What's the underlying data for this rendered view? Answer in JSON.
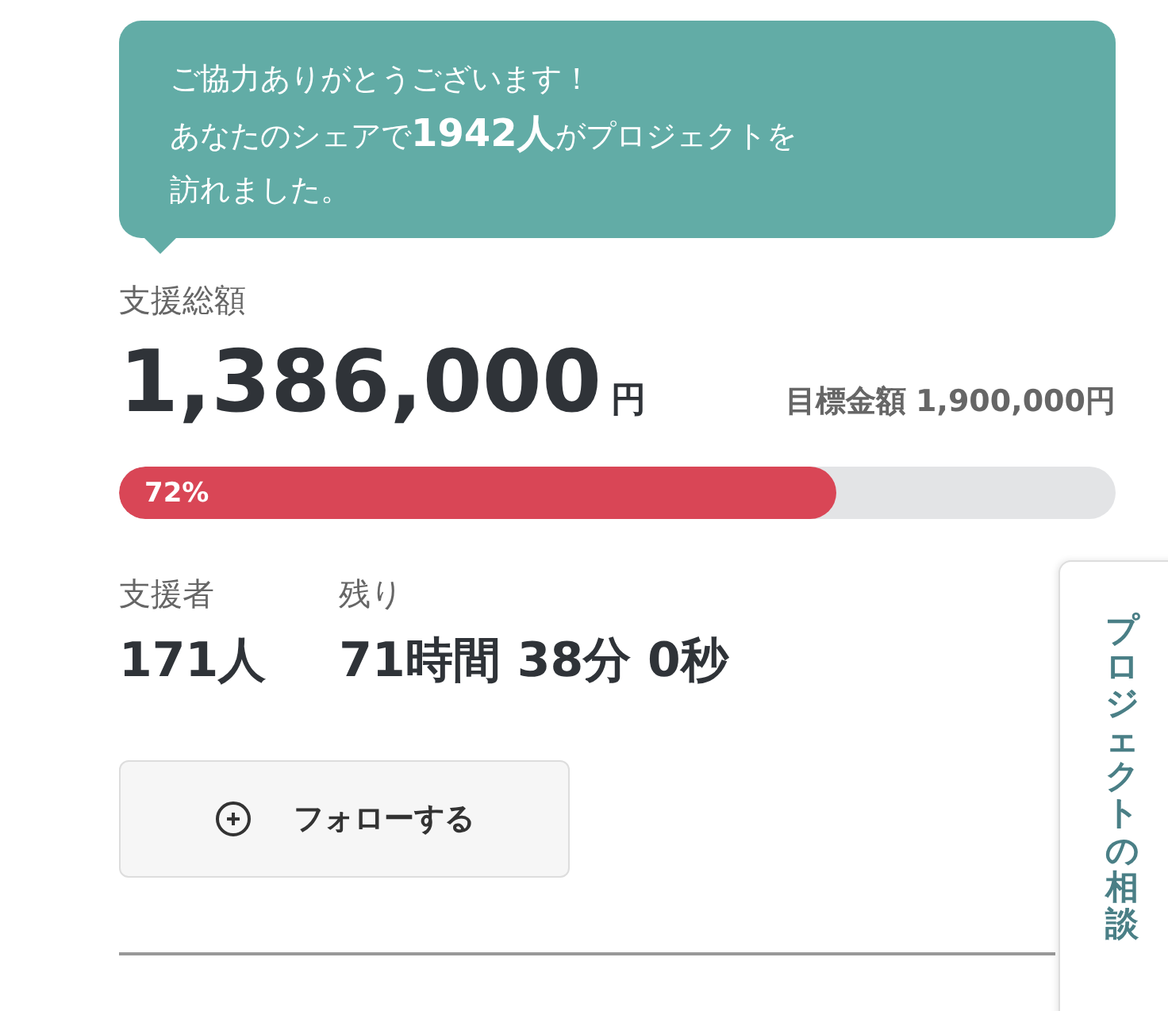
{
  "share_message": {
    "lines": [
      "ご協力ありがとうございます！",
      "あなたのシェアで**1942人**がプロジェクトを",
      "訪れました。"
    ]
  },
  "total": {
    "label": "支援総額",
    "amount": "1,386,000",
    "unit": "円",
    "goal_label": "目標金額",
    "goal_amount": "1,900,000円"
  },
  "progress": {
    "level": 0.72,
    "label": "72%"
  },
  "stats": [
    {
      "label": "支援者",
      "value": "171人"
    },
    {
      "label": "残り",
      "value": "71時間 38分 0秒"
    }
  ],
  "follow_button": {
    "label": "フォローする"
  },
  "side_tab": {
    "label": "プロジェクトの相談"
  }
}
